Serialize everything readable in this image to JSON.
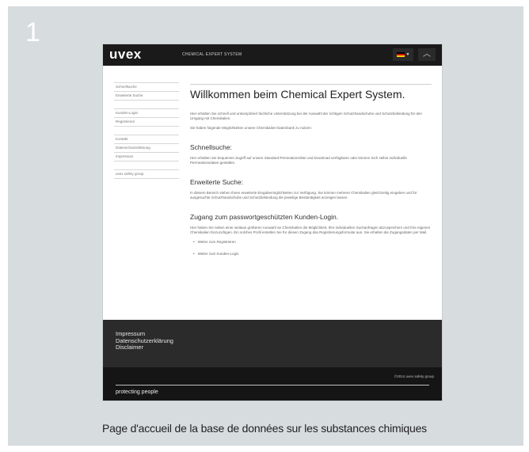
{
  "step_number": "1",
  "caption": "Page d'accueil de la base de données sur les substances chimiques",
  "brand_colors": {
    "panel": "#d7dcdf",
    "topbar": "#1a1a1a",
    "footer": "#2b2b2b",
    "footer_bottom": "#151515"
  },
  "screenshot": {
    "header": {
      "logo": "uvex",
      "app_title": "CHEMICAL EXPERT SYSTEM",
      "language_flag": "de-flag-icon",
      "dropdown_icon": "caret-down-icon",
      "collapse_icon": "chevron-up-icon"
    },
    "sidebar": {
      "groups": [
        [
          "Schnellsuche",
          "Erweiterte Suche"
        ],
        [
          "Kunden-Login",
          "Registrieren"
        ],
        [
          "Kontakt",
          "Datenschutzerklärung",
          "Impressum"
        ],
        [
          "uvex safety group"
        ]
      ]
    },
    "main": {
      "title": "Willkommen beim Chemical Expert System.",
      "intro": "Hier erhalten Sie schnell und unkompliziert fachliche Unterstützung bei der Auswahl der richtigen Schutzhandschuhe und Schutzbekleidung für den Umgang mit Chemikalien.",
      "options_text": "Sie haben folgende Möglichkeiten unsere Chemikalien-Datenbank zu nutzen:",
      "quick_search": {
        "heading": "Schnellsuche:",
        "text": "Hier erhalten Sie bequemen Zugriff auf unsere Standard-Permeationsliste und Download verfügbarer oder können Sich selbst individuelle Permeationsdaten gestalten."
      },
      "advanced_search": {
        "heading": "Erweiterte Suche:",
        "text": "In diesem Bereich stehen Ihnen erweiterte Eingabemöglichkeiten zur Verfügung. Sie können mehrere Chemikalien gleichzeitig eingeben und für ausgesuchte Schutzhandschuhe und Schutzbekleidung die jeweilige Beständigkeit anzeigen lassen."
      },
      "login": {
        "heading": "Zugang zum passwortgeschützten Kunden-Login.",
        "text": "Hier haben Sie neben einer weitaus größeren Auswahl an Chemikalien die Möglichkeit, Ihre individuellen Suchanfragen abzuspeichern und Ihre eigenen Chemikalien hinzuzufügen. Ein solches Profil erstellen Sie für diesen Zugang das Registrierungsformular aus. Sie erhalten die Zugangsdaten per Mail.",
        "links": [
          "Weiter zum Registrieren",
          "Weiter zum Kunden-Login"
        ]
      }
    },
    "footer": {
      "links": [
        "Impressum",
        "Datenschutzerklärung",
        "Disclaimer"
      ],
      "copyright": "©2014 uvex safety group",
      "tagline": "protecting people"
    }
  }
}
